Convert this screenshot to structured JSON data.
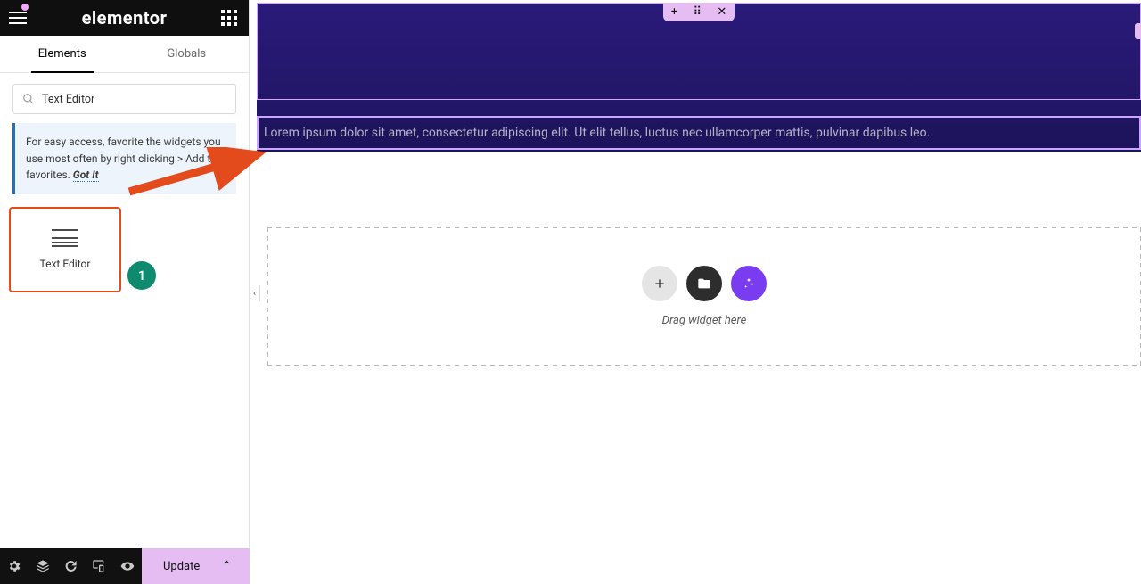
{
  "brand": "elementor",
  "tabs": {
    "elements": "Elements",
    "globals": "Globals"
  },
  "search": {
    "value": "Text Editor"
  },
  "tip": {
    "body": "For easy access, favorite the widgets you use most often by right clicking > Add to favorites.",
    "gotIt": "Got It"
  },
  "widget": {
    "label": "Text Editor"
  },
  "footer": {
    "update": "Update"
  },
  "preview": {
    "textBlock": "Lorem ipsum dolor sit amet, consectetur adipiscing elit. Ut elit tellus, luctus nec ullamcorper mattis, pulvinar dapibus leo.",
    "dropLabel": "Drag widget here"
  },
  "annotation": {
    "step": "1"
  }
}
